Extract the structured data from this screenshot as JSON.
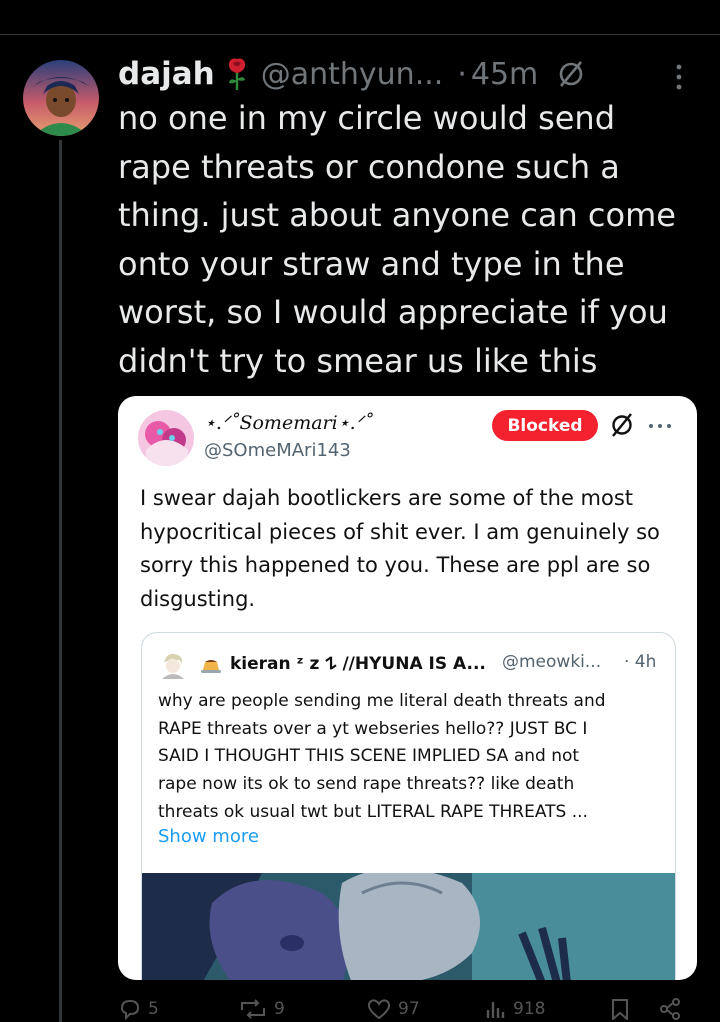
{
  "post": {
    "author_name": "dajah",
    "handle": "@anthyun...",
    "separator": "·",
    "time": "45m",
    "text": "no one in my circle would send\nrape threats or condone such a\nthing. just about anyone can come\nonto your straw and type in the\nworst, so I would appreciate if you\ndidn't try to smear us like this"
  },
  "quote": {
    "display_name": "⋆.ᐟ˚Somemari⋆.ᐟ˚",
    "handle": "@SOmeMAri143",
    "blocked_label": "Blocked",
    "text": "I swear dajah bootlickers are some of the most\nhypocritical pieces of shit ever. I am genuinely so\nsorry this happened to you. These are ppl are so\ndisgusting.",
    "inner": {
      "name": "kieran ᶻ z 𐰁 //HYUNA IS A...",
      "handle": "@meowki...",
      "time": "· 4h",
      "text": "why are people sending me literal death threats and\nRAPE threats over a yt webseries hello?? JUST BC I\nSAID I THOUGHT THIS SCENE IMPLIED SA and not\nrape now its ok to send rape threats?? like death\nthreats ok usual twt but LITERAL RAPE THREATS ...",
      "show_more": "Show more"
    }
  },
  "actions": {
    "replies": "5",
    "reposts": "9",
    "likes": "97",
    "views": "918"
  },
  "colors": {
    "background": "#000000",
    "blocked": "#f4212e",
    "link": "#1d9bf0"
  },
  "icons": [
    "rose-emoji",
    "slashed-circle-icon",
    "more-vertical-icon",
    "more-horizontal-icon",
    "flan-emoji",
    "reply-icon",
    "repost-icon",
    "like-icon",
    "views-icon",
    "bookmark-icon",
    "share-icon"
  ]
}
